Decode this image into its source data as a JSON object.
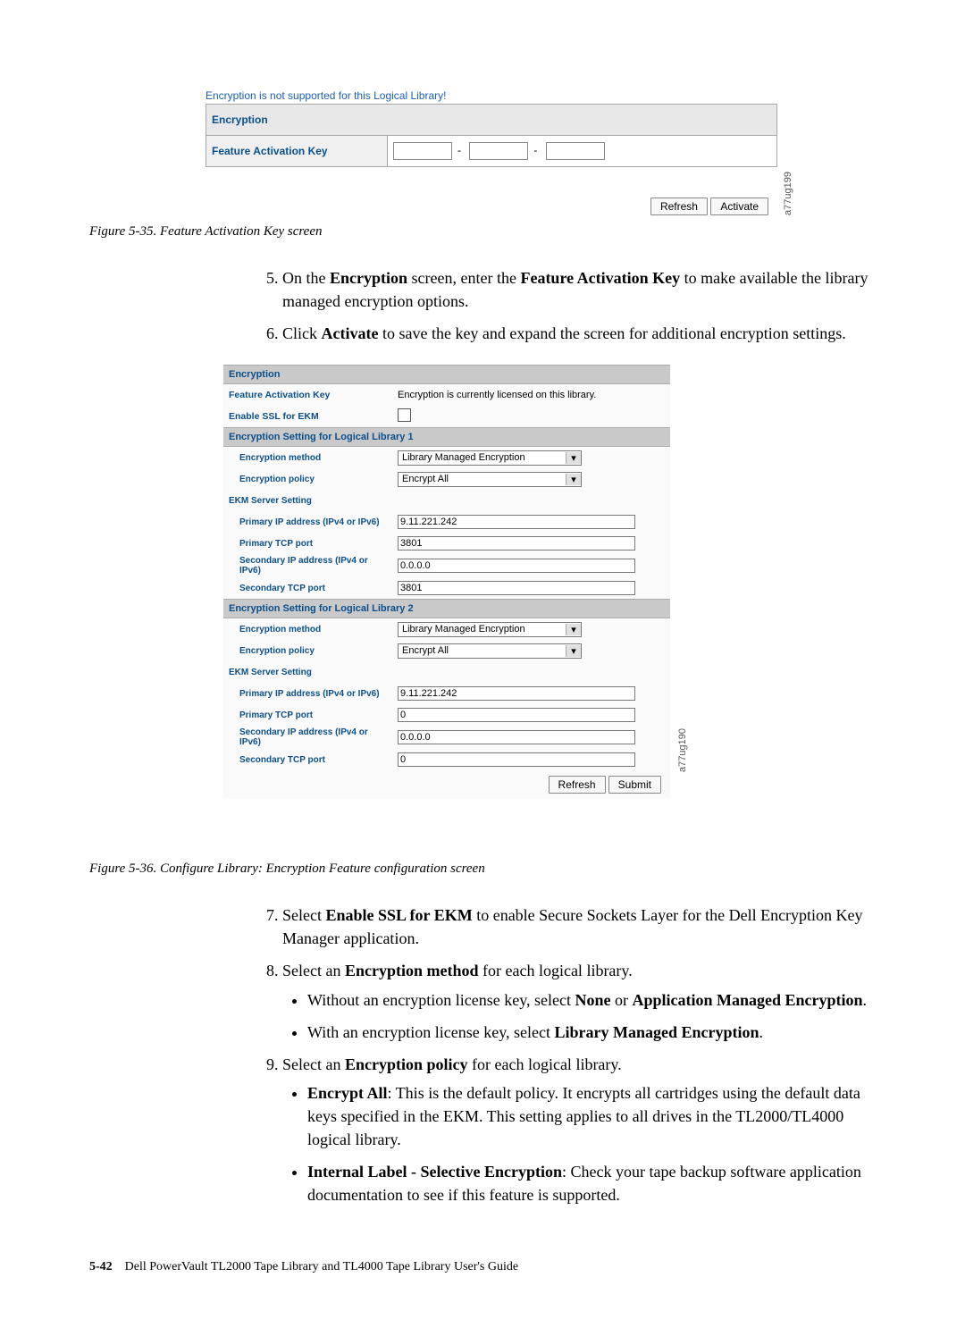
{
  "shot1": {
    "warn": "Encryption is not supported for this Logical Library!",
    "header": "Encryption",
    "fak_label": "Feature Activation Key",
    "fak1": "",
    "fak2": "",
    "fak3": "",
    "refresh": "Refresh",
    "activate": "Activate",
    "imgcode": "a77ug199"
  },
  "caption1": "Figure 5-35. Feature Activation Key screen",
  "step5a": "On the ",
  "step5b": "Encryption",
  "step5c": " screen, enter the ",
  "step5d": "Feature Activation Key",
  "step5e": " to make available the library managed encryption options.",
  "step6a": "Click ",
  "step6b": "Activate",
  "step6c": " to save the key and expand the screen for additional encryption settings.",
  "shot2": {
    "header": "Encryption",
    "fak_label": "Feature Activation Key",
    "fak_status": "Encryption is currently licensed on this library.",
    "ssl_label": "Enable SSL for EKM",
    "lib1_hdr": "Encryption Setting for Logical Library 1",
    "lib2_hdr": "Encryption Setting for Logical Library 2",
    "method_label": "Encryption method",
    "policy_label": "Encryption policy",
    "ekm_label": "EKM Server Setting",
    "primary_ip_label": "Primary IP address (IPv4 or IPv6)",
    "primary_port_label": "Primary TCP port",
    "secondary_ip_label": "Secondary IP address (IPv4 or IPv6)",
    "secondary_port_label": "Secondary TCP port",
    "lib1": {
      "method": "Library Managed Encryption",
      "policy": "Encrypt All",
      "primary_ip": "9.11.221.242",
      "primary_port": "3801",
      "secondary_ip": "0.0.0.0",
      "secondary_port": "3801"
    },
    "lib2": {
      "method": "Library Managed Encryption",
      "policy": "Encrypt All",
      "primary_ip": "9.11.221.242",
      "primary_port": "0",
      "secondary_ip": "0.0.0.0",
      "secondary_port": "0"
    },
    "refresh": "Refresh",
    "submit": "Submit",
    "imgcode": "a77ug190"
  },
  "caption2": "Figure 5-36. Configure Library: Encryption Feature configuration screen",
  "step7a": "Select ",
  "step7b": "Enable SSL for EKM",
  "step7c": " to enable Secure Sockets Layer for the Dell Encryption Key Manager application.",
  "step8a": "Select an ",
  "step8b": "Encryption method",
  "step8c": " for each logical library.",
  "step8_b1a": "Without an encryption license key, select ",
  "step8_b1b": "None",
  "step8_b1c": " or ",
  "step8_b1d": "Application Managed Encryption",
  "step8_b1e": ".",
  "step8_b2a": "With an encryption license key, select ",
  "step8_b2b": "Library Managed Encryption",
  "step8_b2c": ".",
  "step9a": "Select an ",
  "step9b": "Encryption policy",
  "step9c": " for each logical library.",
  "step9_b1a": "Encrypt All",
  "step9_b1b": ": This is the default policy. It encrypts all cartridges using the default data keys specified in the EKM. This setting applies to all drives in the TL2000/TL4000 logical library.",
  "step9_b2a": "Internal Label - Selective Encryption",
  "step9_b2b": ": Check your tape backup software application documentation to see if this feature is supported.",
  "footer": {
    "page": "5-42",
    "title": "Dell PowerVault TL2000 Tape Library and TL4000 Tape Library User's Guide"
  }
}
